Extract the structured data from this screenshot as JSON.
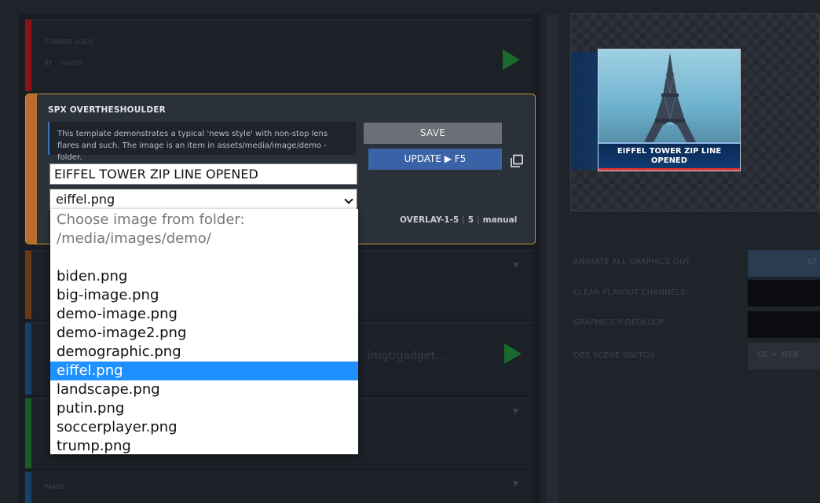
{
  "rundown": {
    "dimmed_items": [
      {
        "label": "CORNER LOGO",
        "tag": "LOGO",
        "sub": "Itr · name",
        "strip": "#8b1515"
      },
      {
        "label": "",
        "tag": "",
        "sub": "",
        "strip": "#6a3a16"
      },
      {
        "label": "",
        "tag": "",
        "sub": "imgt/gadget...",
        "strip": "#17406b"
      },
      {
        "label": "",
        "tag": "",
        "sub": "",
        "strip": "#1b5c25"
      },
      {
        "label": "IMAGE",
        "tag": "IMAGE",
        "sub": "",
        "strip": "#17406b"
      }
    ],
    "active": {
      "title": "SPX OVERTHESHOULDER",
      "description": "This template demonstrates a typical 'news style' with non-stop lens flares and such. The image is an item in assets/media/image/demo -folder.",
      "save_label": "SAVE",
      "update_label": "UPDATE ▶ F5",
      "text_value": "EIFFEL TOWER ZIP LINE OPENED",
      "select_value": "eiffel.png",
      "meta": {
        "server": "OVERLAY-1-5",
        "layer": "5",
        "mode": "manual"
      },
      "accent": "#c09632",
      "strip": "#b86d2e"
    }
  },
  "dropdown": {
    "header_line1": "Choose image from folder:",
    "header_line2": "/media/images/demo/",
    "options": [
      "biden.png",
      "big-image.png",
      "demo-image.png",
      "demo-image2.png",
      "demographic.png",
      "eiffel.png",
      "landscape.png",
      "putin.png",
      "soccerplayer.png",
      "trump.png"
    ],
    "selected_index": 5
  },
  "preview": {
    "caption": "EIFFEL TOWER ZIP LINE OPENED",
    "accent": "#1d5c9e"
  },
  "controls": [
    {
      "label": "ANIMATE ALL GRAPHICS OUT",
      "button": "ST"
    },
    {
      "label": "CLEAR PLAYOUT CHANNELS",
      "button": ""
    },
    {
      "label": "GRAPHICS VIDEOLOOP",
      "button": ""
    },
    {
      "label": "OBS SCENE SWITCH",
      "button": "GC + WEB"
    }
  ]
}
